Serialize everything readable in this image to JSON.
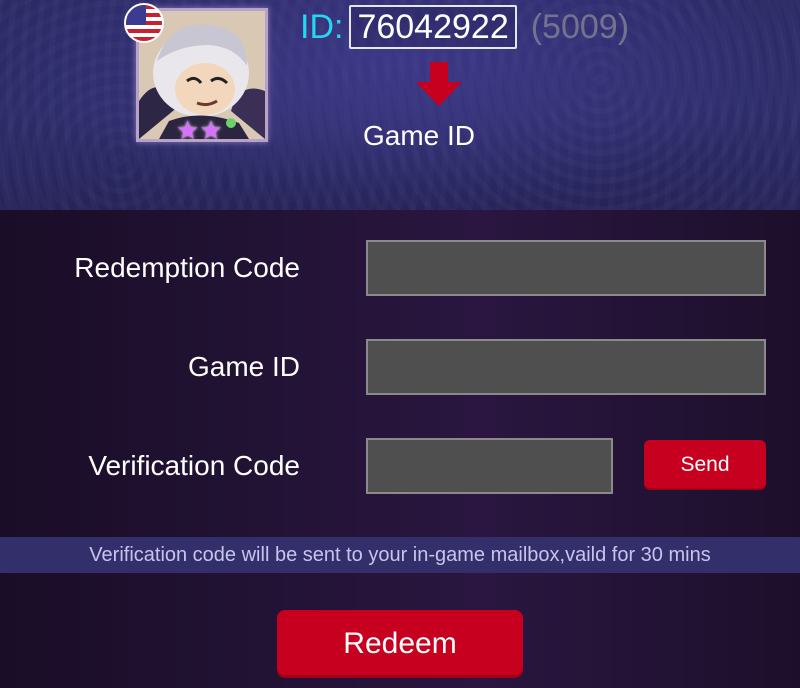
{
  "header": {
    "id_label": "ID:",
    "game_id_value": "76042922",
    "zone_id": "(5009)",
    "caption": "Game ID",
    "flag_icon": "us-flag-icon",
    "avatar_icon": "hero-avatar-icon",
    "arrow_icon": "arrow-down-icon",
    "arrow_color": "#c8001f",
    "star_count": 2
  },
  "form": {
    "redemption_label": "Redemption Code",
    "redemption_value": "",
    "game_id_label": "Game ID",
    "game_id_input_value": "",
    "verification_label": "Verification Code",
    "verification_value": "",
    "send_label": "Send",
    "notice": "Verification code will be sent to your in-game mailbox,vaild for 30 mins",
    "redeem_label": "Redeem"
  },
  "colors": {
    "accent_red": "#c8001f",
    "id_cyan": "#24d6f2",
    "notice_bg": "#332f6a"
  }
}
